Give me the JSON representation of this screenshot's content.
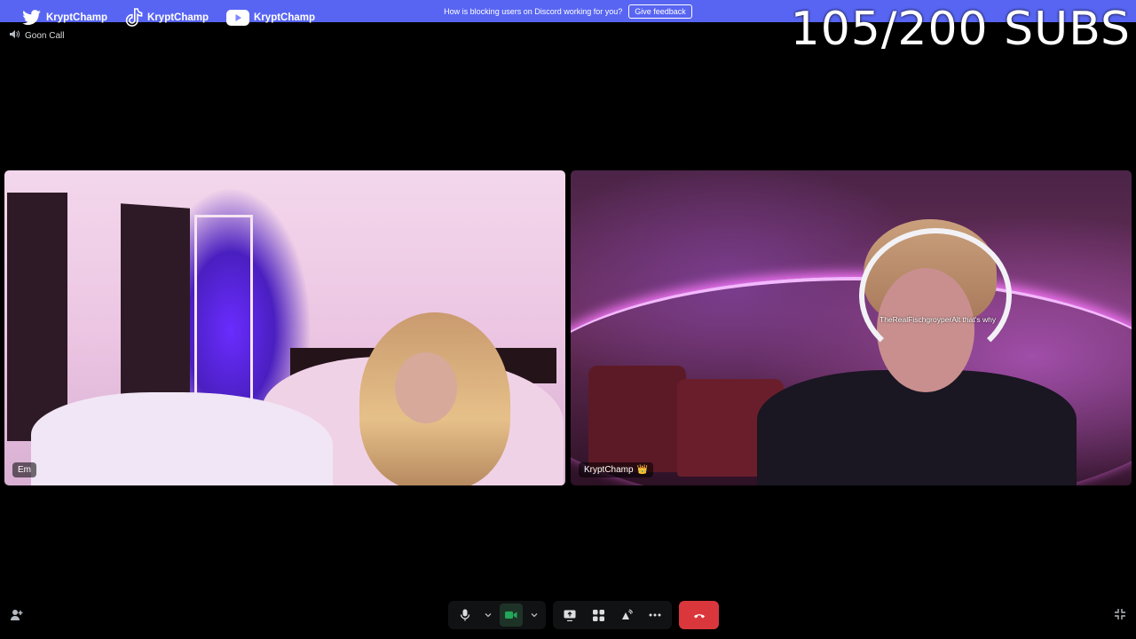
{
  "banner": {
    "text": "How is blocking users on Discord working for you?",
    "button": "Give feedback"
  },
  "socials": [
    {
      "icon": "twitter-icon",
      "label": "KryptChamp"
    },
    {
      "icon": "tiktok-icon",
      "label": "KryptChamp"
    },
    {
      "icon": "youtube-icon",
      "label": "KryptChamp"
    }
  ],
  "subs_counter": "105/200 SUBS",
  "call": {
    "title": "Goon Call",
    "icon": "speaker-icon"
  },
  "tiles": [
    {
      "name": "Em"
    },
    {
      "name": "KryptChamp",
      "badge": "👑",
      "overlay_text": "TheRealFischgroyperAlt  that's why"
    }
  ],
  "controls": {
    "mic": "microphone-icon",
    "camera": "camera-icon",
    "screen_share": "screen-share-icon",
    "activities": "activities-icon",
    "soundboard": "soundboard-icon",
    "more": "more-icon",
    "hangup": "hangup-icon"
  },
  "colors": {
    "banner": "#5865f2",
    "hangup": "#da373c",
    "camera_active": "#23a55a"
  }
}
